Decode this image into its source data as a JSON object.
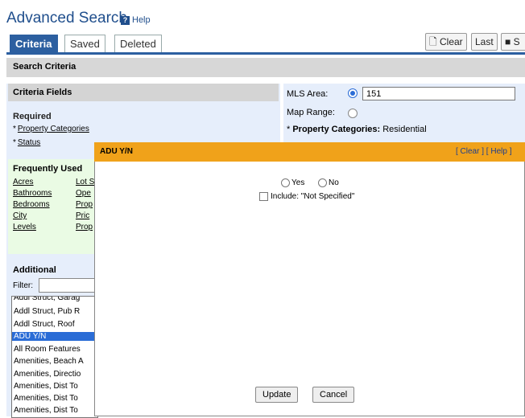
{
  "header": {
    "title": "Advanced Search",
    "help_label": "Help"
  },
  "tabs": [
    {
      "label": "Criteria"
    },
    {
      "label": "Saved"
    },
    {
      "label": "Deleted"
    }
  ],
  "toolbar": {
    "clear_label": "Clear",
    "last_label": "Last",
    "save_label": "S"
  },
  "search_criteria": {
    "bar_label": "Search Criteria",
    "fields_header": "Criteria Fields",
    "required_label": "Required",
    "required_items": [
      {
        "label": "Property Categories"
      },
      {
        "label": "Status"
      }
    ],
    "frequently_used_label": "Frequently Used",
    "frequently_used_items": [
      {
        "label": "Acres"
      },
      {
        "label": "Bathrooms"
      },
      {
        "label": "Bedrooms"
      },
      {
        "label": "City"
      },
      {
        "label": "Levels"
      },
      {
        "label": "Lot S"
      },
      {
        "label": "Ope"
      },
      {
        "label": "Prop"
      },
      {
        "label": "Pric"
      },
      {
        "label": "Prop"
      }
    ],
    "additional_label": "Additional",
    "filter_label": "Filter:",
    "filter_value": "",
    "additional_list": [
      {
        "label": "Addl Struct, Garag"
      },
      {
        "label": "Addl Struct, Pub R"
      },
      {
        "label": "Addl Struct, Roof"
      },
      {
        "label": "ADU Y/N"
      },
      {
        "label": "All Room Features"
      },
      {
        "label": "Amenities, Beach A"
      },
      {
        "label": "Amenities, Directio"
      },
      {
        "label": "Amenities, Dist To"
      },
      {
        "label": "Amenities, Dist To"
      },
      {
        "label": "Amenities, Dist To"
      }
    ],
    "selected_index": 3
  },
  "right_panel": {
    "mls_area_label": "MLS Area:",
    "mls_area_value": "151",
    "map_range_label": "Map Range:",
    "property_categories_label": "Property Categories:",
    "property_categories_value": "Residential"
  },
  "modal": {
    "title": "ADU Y/N",
    "clear_link": "[ Clear ]",
    "help_link": "[ Help ]",
    "yes_label": "Yes",
    "no_label": "No",
    "include_label": "Include: \"Not Specified\"",
    "update_label": "Update",
    "cancel_label": "Cancel"
  },
  "colors": {
    "brand": "#1f4e8c",
    "tab_active": "#2c5fa0",
    "modal_header": "#f0a21a",
    "selection": "#2a6cd6"
  }
}
